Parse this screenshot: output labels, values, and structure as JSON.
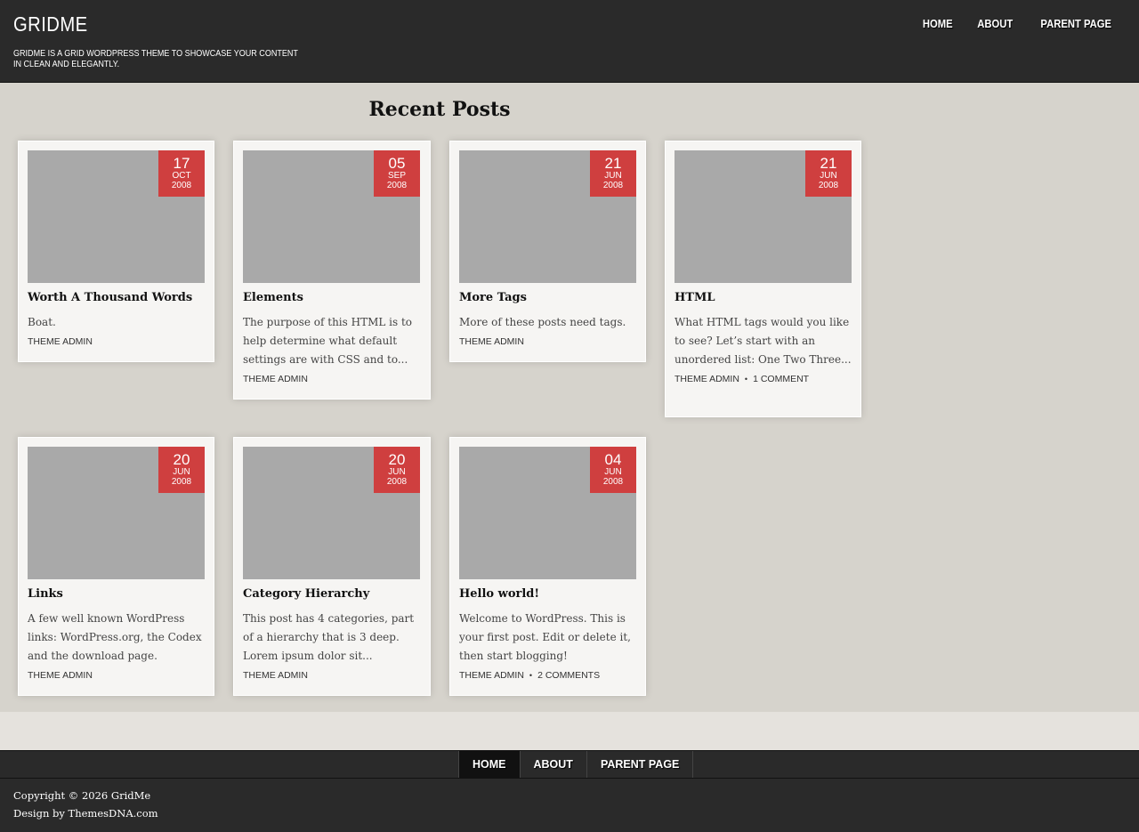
{
  "header": {
    "site_title": "GRIDME",
    "tagline": "GRIDME IS A GRID WORDPRESS THEME TO SHOWCASE YOUR CONTENT IN CLEAN AND ELEGANTLY.",
    "nav": [
      "HOME",
      "ABOUT",
      "PARENT PAGE"
    ]
  },
  "main": {
    "section_title": "Recent Posts",
    "posts": [
      {
        "day": "17",
        "month": "OCT",
        "year": "2008",
        "title": "Worth A Thousand Words",
        "excerpt": "Boat.",
        "author": "THEME ADMIN",
        "comments": ""
      },
      {
        "day": "05",
        "month": "SEP",
        "year": "2008",
        "title": "Elements",
        "excerpt": "The purpose of this HTML is to help determine what default settings are with CSS and to...",
        "author": "THEME ADMIN",
        "comments": ""
      },
      {
        "day": "21",
        "month": "JUN",
        "year": "2008",
        "title": "More Tags",
        "excerpt": "More of these posts need tags.",
        "author": "THEME ADMIN",
        "comments": ""
      },
      {
        "day": "21",
        "month": "JUN",
        "year": "2008",
        "title": "HTML",
        "excerpt": "What HTML tags would you like to see? Let’s start with an unordered list: One Two Three...",
        "author": "THEME ADMIN",
        "comments": "1 COMMENT"
      },
      {
        "day": "20",
        "month": "JUN",
        "year": "2008",
        "title": "Links",
        "excerpt": "A few well known WordPress links: WordPress.org, the Codex and the download page.",
        "author": "THEME ADMIN",
        "comments": ""
      },
      {
        "day": "20",
        "month": "JUN",
        "year": "2008",
        "title": "Category Hierarchy",
        "excerpt": "This post has 4 categories, part of a hierarchy that is 3 deep. Lorem ipsum dolor sit...",
        "author": "THEME ADMIN",
        "comments": ""
      },
      {
        "day": "04",
        "month": "JUN",
        "year": "2008",
        "title": "Hello world!",
        "excerpt": "Welcome to WordPress. This is your first post. Edit or delete it, then start blogging!",
        "author": "THEME ADMIN",
        "comments": "2 COMMENTS"
      }
    ]
  },
  "footer": {
    "nav": [
      "HOME",
      "ABOUT",
      "PARENT PAGE"
    ],
    "copyright": "Copyright © 2026 GridMe",
    "credit": "Design by ThemesDNA.com"
  },
  "colors": {
    "header_bg": "#2a2a2a",
    "date_badge": "#cf3f3f",
    "thumb_placeholder": "#a9a9a9"
  }
}
